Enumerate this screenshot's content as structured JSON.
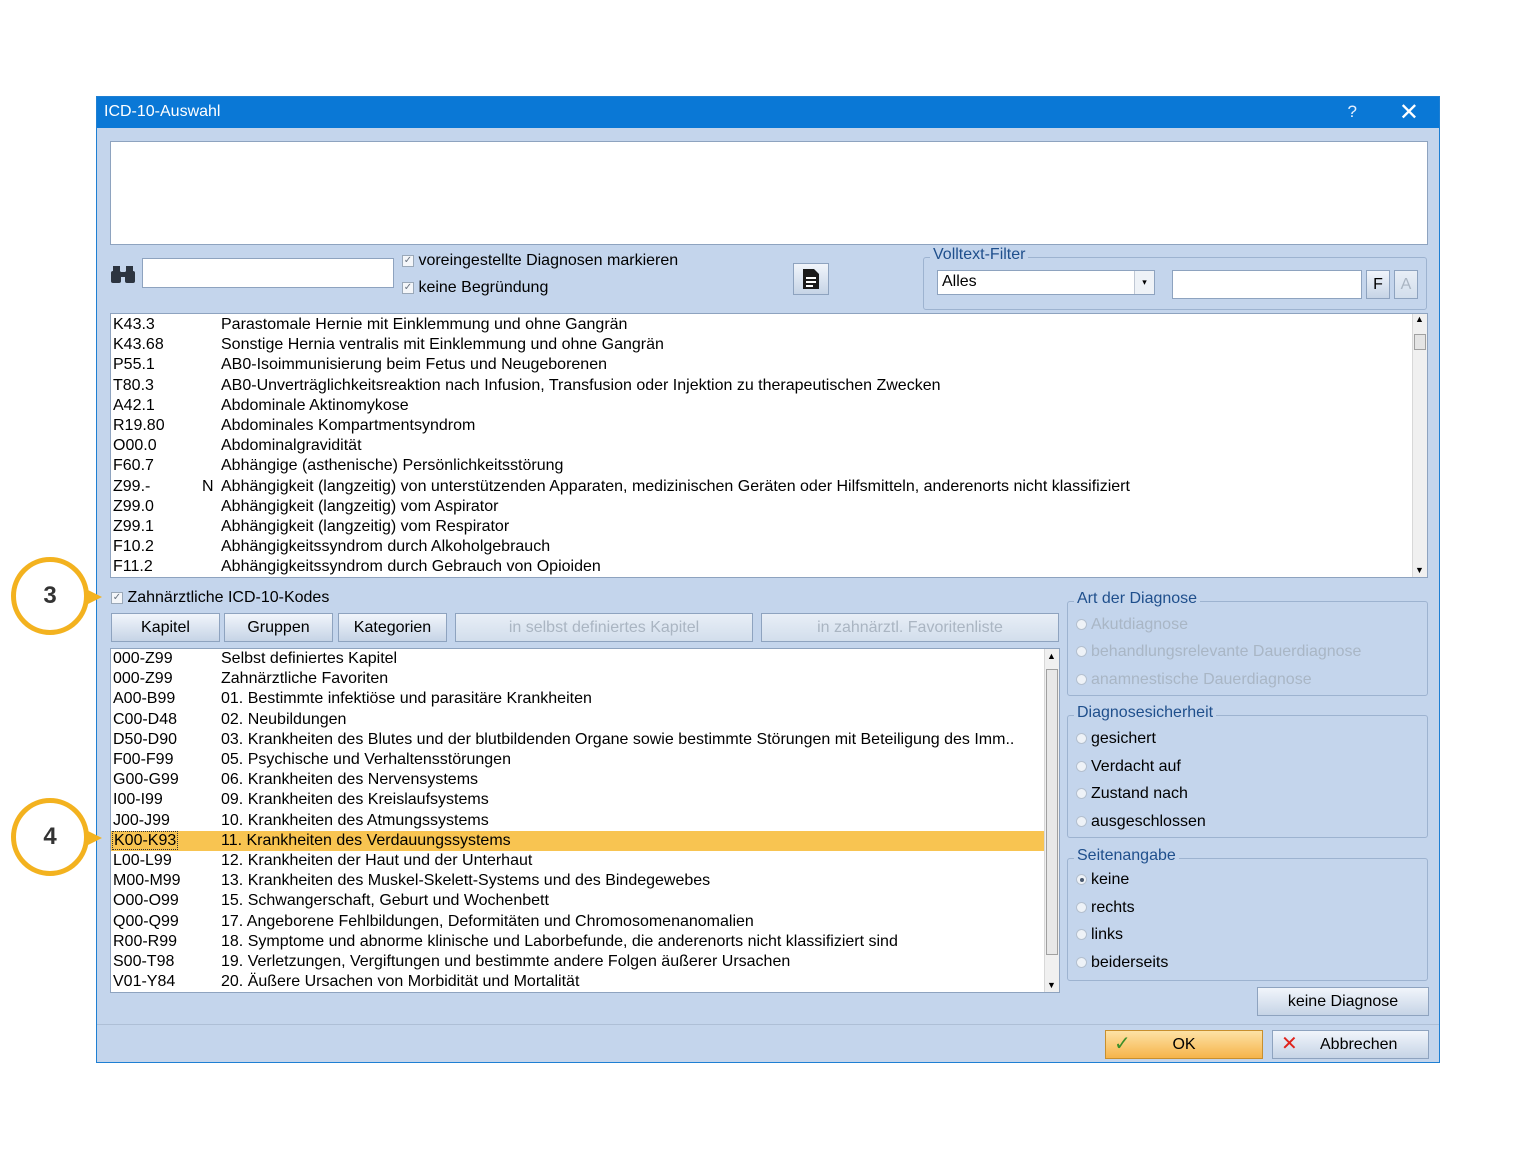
{
  "window": {
    "title": "ICD-10-Auswahl",
    "help_label": "?",
    "close_label": "✕"
  },
  "search": {
    "check_preset": "voreingestellte Diagnosen markieren",
    "check_no_reason": "keine Begründung"
  },
  "volltext": {
    "legend": "Volltext-Filter",
    "combo_value": "Alles",
    "btn_f": "F",
    "btn_a": "A"
  },
  "upper_list": [
    {
      "code": "K43.3",
      "flag": "",
      "desc": "Parastomale Hernie mit Einklemmung und ohne Gangrän"
    },
    {
      "code": "K43.68",
      "flag": "",
      "desc": "Sonstige Hernia ventralis mit Einklemmung und ohne Gangrän"
    },
    {
      "code": "P55.1",
      "flag": "",
      "desc": "AB0-Isoimmunisierung beim Fetus und Neugeborenen"
    },
    {
      "code": "T80.3",
      "flag": "",
      "desc": "AB0-Unverträglichkeitsreaktion nach Infusion, Transfusion oder Injektion zu therapeutischen Zwecken"
    },
    {
      "code": "A42.1",
      "flag": "",
      "desc": "Abdominale Aktinomykose"
    },
    {
      "code": "R19.80",
      "flag": "",
      "desc": "Abdominales Kompartmentsyndrom"
    },
    {
      "code": "O00.0",
      "flag": "",
      "desc": "Abdominalgravidität"
    },
    {
      "code": "F60.7",
      "flag": "",
      "desc": "Abhängige (asthenische) Persönlichkeitsstörung"
    },
    {
      "code": "Z99.-",
      "flag": "N",
      "desc": "Abhängigkeit (langzeitig) von unterstützenden Apparaten, medizinischen Geräten oder Hilfsmitteln, anderenorts nicht klassifiziert"
    },
    {
      "code": "Z99.0",
      "flag": "",
      "desc": "Abhängigkeit (langzeitig) vom Aspirator"
    },
    {
      "code": "Z99.1",
      "flag": "",
      "desc": "Abhängigkeit (langzeitig) vom Respirator"
    },
    {
      "code": "F10.2",
      "flag": "",
      "desc": "Abhängigkeitssyndrom durch Alkoholgebrauch"
    },
    {
      "code": "F11.2",
      "flag": "",
      "desc": "Abhängigkeitssyndrom durch Gebrauch von Opioiden"
    }
  ],
  "zahn": {
    "label": "Zahnärztliche ICD-10-Kodes"
  },
  "buttons": {
    "kapitel": "Kapitel",
    "gruppen": "Gruppen",
    "kategorien": "Kategorien",
    "selbst": "in selbst definiertes Kapitel",
    "favoriten": "in zahnärztl. Favoritenliste",
    "keine_diagnose": "keine Diagnose",
    "ok": "OK",
    "abbrechen": "Abbrechen"
  },
  "chapter_list": [
    {
      "code": "000-Z99",
      "desc": "Selbst definiertes Kapitel"
    },
    {
      "code": "000-Z99",
      "desc": "Zahnärztliche Favoriten"
    },
    {
      "code": "A00-B99",
      "desc": "01. Bestimmte infektiöse und parasitäre Krankheiten"
    },
    {
      "code": "C00-D48",
      "desc": "02. Neubildungen"
    },
    {
      "code": "D50-D90",
      "desc": "03. Krankheiten des Blutes und der blutbildenden Organe sowie bestimmte Störungen mit Beteiligung des Imm.."
    },
    {
      "code": "F00-F99",
      "desc": "05. Psychische und Verhaltensstörungen"
    },
    {
      "code": "G00-G99",
      "desc": "06. Krankheiten des Nervensystems"
    },
    {
      "code": "I00-I99",
      "desc": "09. Krankheiten des Kreislaufsystems"
    },
    {
      "code": "J00-J99",
      "desc": "10. Krankheiten des Atmungssystems"
    },
    {
      "code": "K00-K93",
      "desc": "11. Krankheiten des Verdauungssystems",
      "selected": true
    },
    {
      "code": "L00-L99",
      "desc": "12. Krankheiten der Haut und der Unterhaut"
    },
    {
      "code": "M00-M99",
      "desc": "13. Krankheiten des Muskel-Skelett-Systems und des Bindegewebes"
    },
    {
      "code": "O00-O99",
      "desc": "15. Schwangerschaft, Geburt und Wochenbett"
    },
    {
      "code": "Q00-Q99",
      "desc": "17. Angeborene Fehlbildungen, Deformitäten und Chromosomenanomalien"
    },
    {
      "code": "R00-R99",
      "desc": "18. Symptome und abnorme klinische und Laborbefunde, die anderenorts nicht klassifiziert sind"
    },
    {
      "code": "S00-T98",
      "desc": "19. Verletzungen, Vergiftungen und bestimmte andere Folgen äußerer Ursachen"
    },
    {
      "code": "V01-Y84",
      "desc": "20. Äußere Ursachen von Morbidität und Mortalität"
    }
  ],
  "art": {
    "legend": "Art der Diagnose",
    "options": [
      "Akutdiagnose",
      "behandlungsrelevante Dauerdiagnose",
      "anamnestische Dauerdiagnose"
    ]
  },
  "sicherheit": {
    "legend": "Diagnosesicherheit",
    "options": [
      "gesichert",
      "Verdacht auf",
      "Zustand nach",
      "ausgeschlossen"
    ]
  },
  "seite": {
    "legend": "Seitenangabe",
    "options": [
      "keine",
      "rechts",
      "links",
      "beiderseits"
    ],
    "selected": "keine"
  },
  "callouts": {
    "c3": "3",
    "c4": "4"
  },
  "colors": {
    "titlebar": "#0a78d6",
    "dialog_bg": "#c4d5ec",
    "selection": "#f8c451",
    "callout": "#f3b21f"
  }
}
